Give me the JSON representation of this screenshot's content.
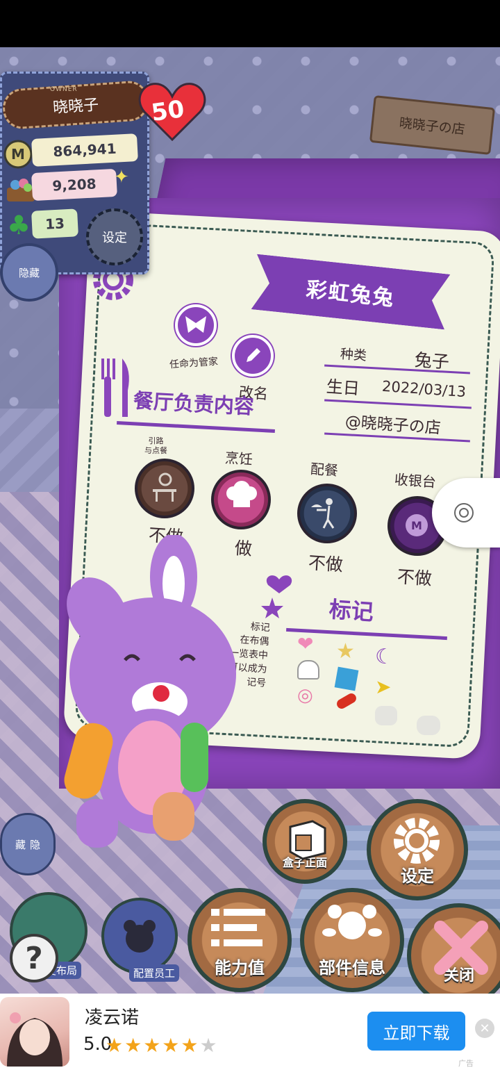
{
  "player": {
    "owner_label": "OWNER",
    "name": "晓晓子",
    "level": "50",
    "coins": "864,941",
    "materials": "9,208",
    "clover": "13",
    "settings_label": "设定",
    "hide_label": "隐藏"
  },
  "shop_sign": "晓晓子の店",
  "doll": {
    "name": "彩虹兔兔",
    "assign_butler_label": "任命为管家",
    "rename_label": "改名",
    "species_label": "种类",
    "species_value": "兔子",
    "birthday_label": "生日",
    "birthday_value": "2022/03/13",
    "shop": "@晓晓子の店"
  },
  "duties": {
    "title": "餐厅负责内容",
    "items": [
      {
        "label": "引路\n与点餐",
        "status": "不做"
      },
      {
        "label": "烹饪",
        "status": "做"
      },
      {
        "label": "配餐",
        "status": "不做"
      },
      {
        "label": "收银台",
        "status": "不做"
      }
    ]
  },
  "marks": {
    "title": "标记",
    "description": "标记\n在布偶\n一览表中\n可以成为\n记号"
  },
  "left_controls": {
    "hide_label": "隐\n藏",
    "help": "?",
    "layout_label": "变布局",
    "staff_label": "配置员工"
  },
  "bottom_buttons": {
    "box_front": "盒子正面",
    "settings": "设定",
    "ability": "能力值",
    "parts": "部件信息",
    "close": "关闭"
  },
  "ad": {
    "title": "凌云诺",
    "rating": "5.0",
    "download": "立即下载",
    "ad_tag": "广告"
  },
  "colors": {
    "accent": "#7c3fb3",
    "card": "#f3f4e4",
    "download_button": "#1c8ef0"
  }
}
